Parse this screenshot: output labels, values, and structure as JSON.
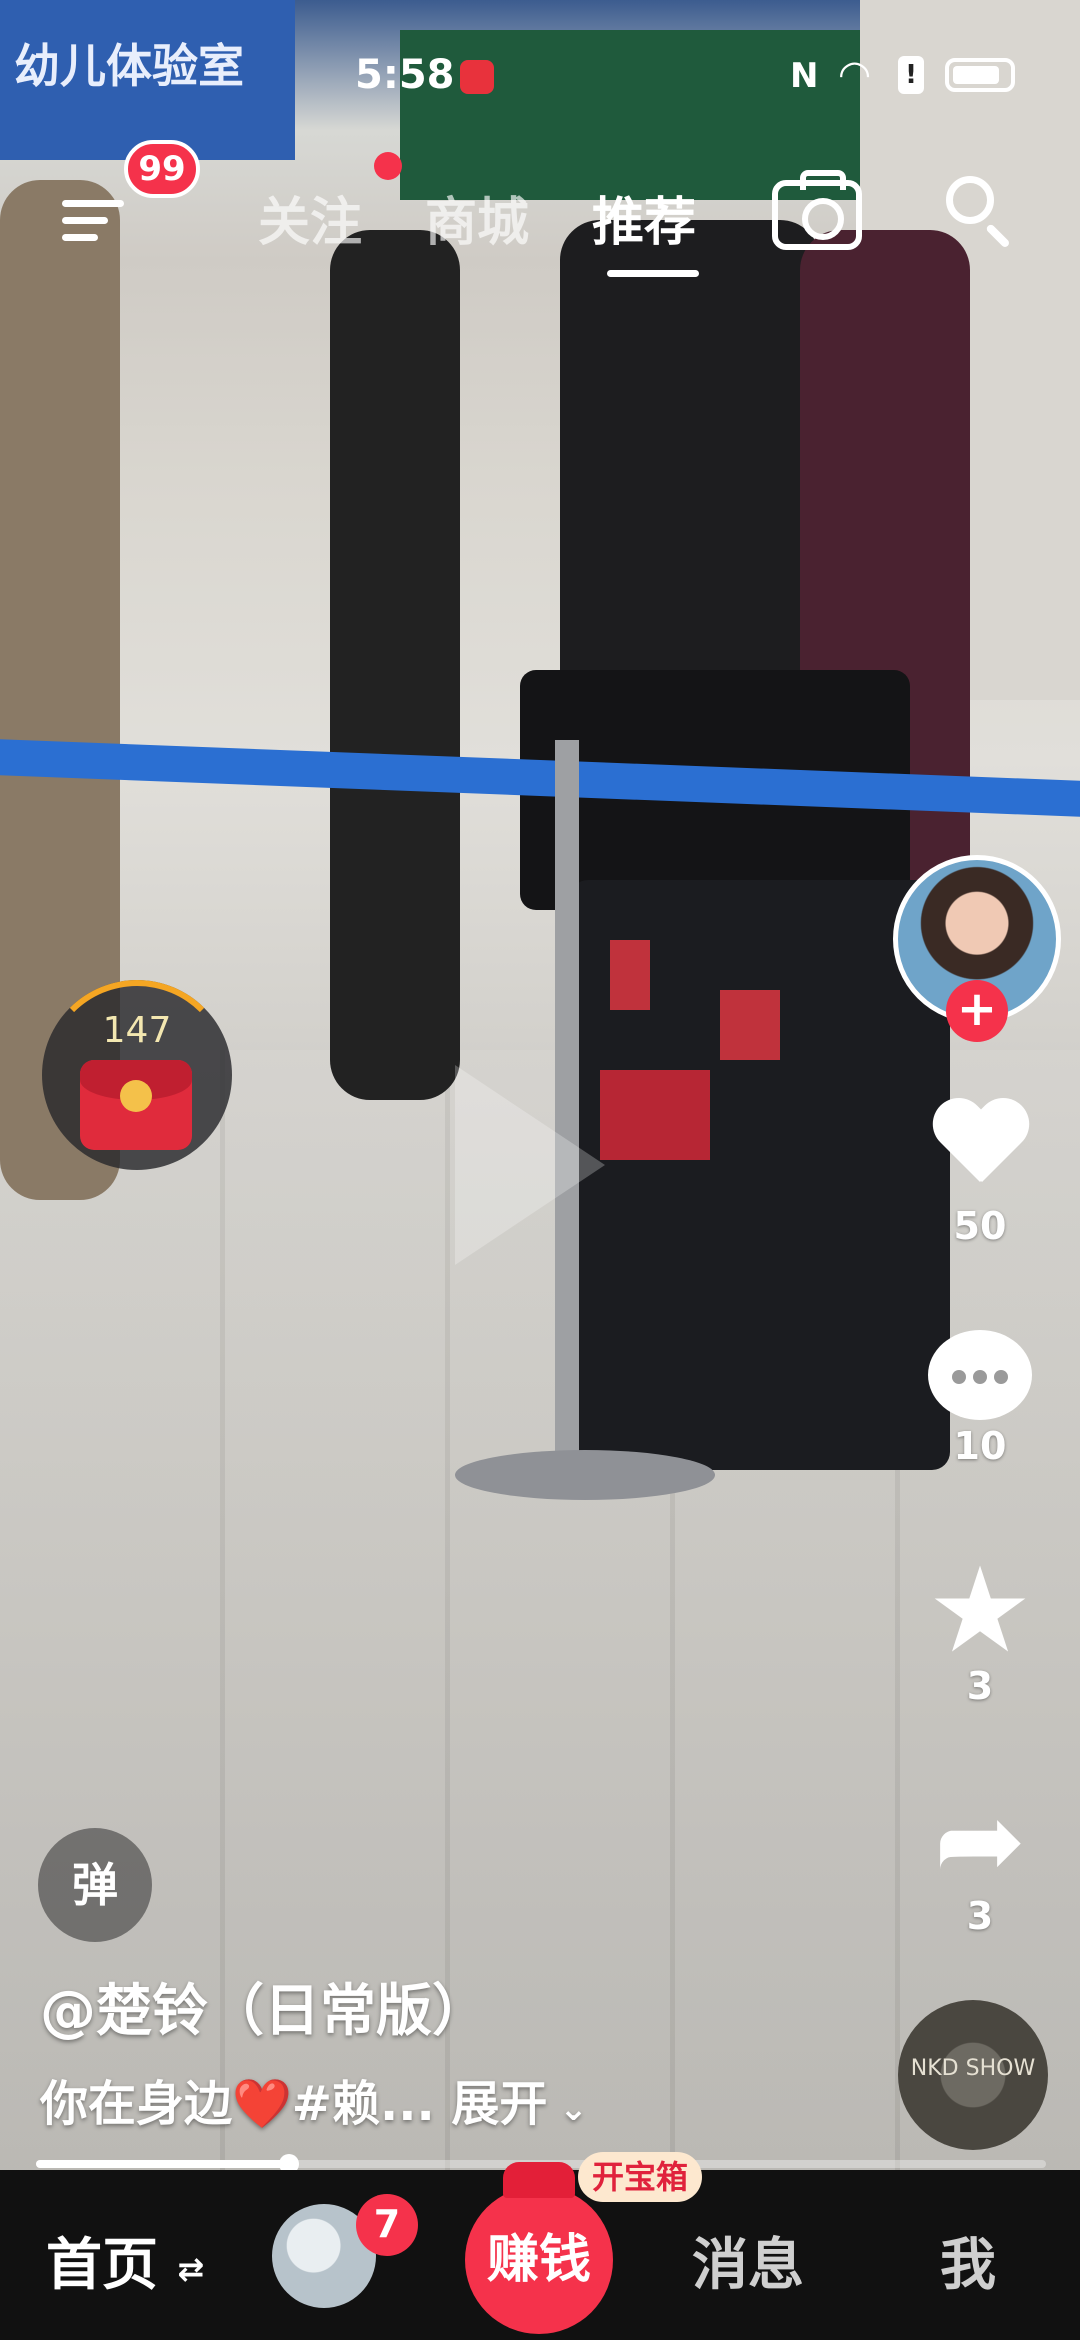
{
  "status_bar": {
    "time": "5:58",
    "nfc_label": "N",
    "icons": [
      "app-notification-icon",
      "nfc-icon",
      "wifi-icon",
      "alert-icon",
      "battery-icon"
    ]
  },
  "background_sign": "幼儿体验室",
  "top_nav": {
    "menu_badge": "99",
    "tabs": [
      {
        "label": "关注",
        "active": false
      },
      {
        "label": "商城",
        "active": false
      },
      {
        "label": "推荐",
        "active": true
      }
    ]
  },
  "red_packet": {
    "count": "147"
  },
  "creator": {
    "follow_symbol": "+"
  },
  "actions": {
    "likes": "50",
    "comments": "10",
    "favorites": "3",
    "shares": "3"
  },
  "danmu_label": "弹",
  "post": {
    "author": "@楚铃（日常版）",
    "description": "你在身边❤️#赖...",
    "expand_label": "展开",
    "progress": 0.25
  },
  "music_disc_label": "NKD SHOW",
  "bottom_nav": {
    "home": "首页",
    "friends_badge": "7",
    "earn": "赚钱",
    "treasure": "开宝箱",
    "messages": "消息",
    "me": "我"
  },
  "colors": {
    "accent": "#f5324b",
    "nav_bg": "#111111"
  }
}
